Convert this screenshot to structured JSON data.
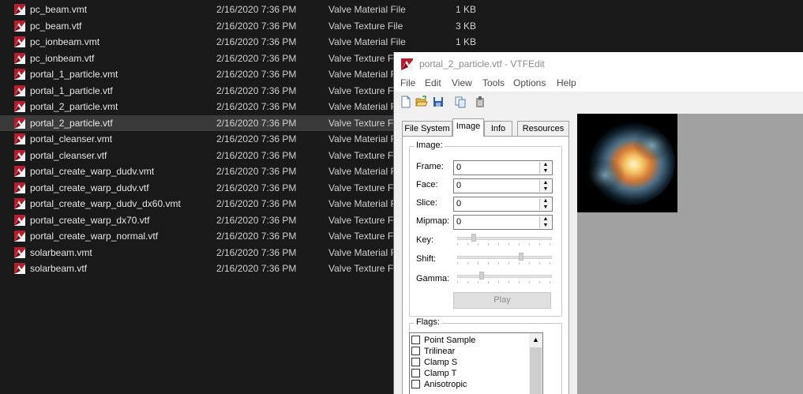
{
  "explorer": {
    "files": [
      {
        "name": "pc_beam.vmt",
        "date": "2/16/2020 7:36 PM",
        "type": "Valve Material File",
        "size": "1 KB"
      },
      {
        "name": "pc_beam.vtf",
        "date": "2/16/2020 7:36 PM",
        "type": "Valve Texture File",
        "size": "3 KB"
      },
      {
        "name": "pc_ionbeam.vmt",
        "date": "2/16/2020 7:36 PM",
        "type": "Valve Material File",
        "size": "1 KB"
      },
      {
        "name": "pc_ionbeam.vtf",
        "date": "2/16/2020 7:36 PM",
        "type": "Valve Texture File",
        "size": ""
      },
      {
        "name": "portal_1_particle.vmt",
        "date": "2/16/2020 7:36 PM",
        "type": "Valve Material File",
        "size": ""
      },
      {
        "name": "portal_1_particle.vtf",
        "date": "2/16/2020 7:36 PM",
        "type": "Valve Texture File",
        "size": ""
      },
      {
        "name": "portal_2_particle.vmt",
        "date": "2/16/2020 7:36 PM",
        "type": "Valve Material File",
        "size": ""
      },
      {
        "name": "portal_2_particle.vtf",
        "date": "2/16/2020 7:36 PM",
        "type": "Valve Texture File",
        "size": ""
      },
      {
        "name": "portal_cleanser.vmt",
        "date": "2/16/2020 7:36 PM",
        "type": "Valve Material File",
        "size": ""
      },
      {
        "name": "portal_cleanser.vtf",
        "date": "2/16/2020 7:36 PM",
        "type": "Valve Texture File",
        "size": ""
      },
      {
        "name": "portal_create_warp_dudv.vmt",
        "date": "2/16/2020 7:36 PM",
        "type": "Valve Material File",
        "size": ""
      },
      {
        "name": "portal_create_warp_dudv.vtf",
        "date": "2/16/2020 7:36 PM",
        "type": "Valve Texture File",
        "size": ""
      },
      {
        "name": "portal_create_warp_dudv_dx60.vmt",
        "date": "2/16/2020 7:36 PM",
        "type": "Valve Material File",
        "size": ""
      },
      {
        "name": "portal_create_warp_dx70.vtf",
        "date": "2/16/2020 7:36 PM",
        "type": "Valve Texture File",
        "size": ""
      },
      {
        "name": "portal_create_warp_normal.vtf",
        "date": "2/16/2020 7:36 PM",
        "type": "Valve Texture File",
        "size": ""
      },
      {
        "name": "solarbeam.vmt",
        "date": "2/16/2020 7:36 PM",
        "type": "Valve Material File",
        "size": ""
      },
      {
        "name": "solarbeam.vtf",
        "date": "2/16/2020 7:36 PM",
        "type": "Valve Texture File",
        "size": ""
      }
    ],
    "file_icon": "valve-file-icon"
  },
  "vtfedit": {
    "title": "portal_2_particle.vtf - VTFEdit",
    "menu": [
      "File",
      "Edit",
      "View",
      "Tools",
      "Options",
      "Help"
    ],
    "toolbar_icons": [
      "new-icon",
      "open-icon",
      "save-icon",
      "copy-icon",
      "paste-icon"
    ],
    "tabs": [
      "File System",
      "Image",
      "Info",
      "Resources"
    ],
    "active_tab": "Image",
    "image_group": {
      "label": "Image:",
      "frame_label": "Frame:",
      "frame_value": "0",
      "face_label": "Face:",
      "face_value": "0",
      "slice_label": "Slice:",
      "slice_value": "0",
      "mipmap_label": "Mipmap:",
      "mipmap_value": "0",
      "key_label": "Key:",
      "shift_label": "Shift:",
      "gamma_label": "Gamma:",
      "play_label": "Play"
    },
    "flags_group": {
      "label": "Flags:",
      "items": [
        "Point Sample",
        "Trilinear",
        "Clamp S",
        "Clamp T",
        "Anisotropic"
      ]
    }
  }
}
